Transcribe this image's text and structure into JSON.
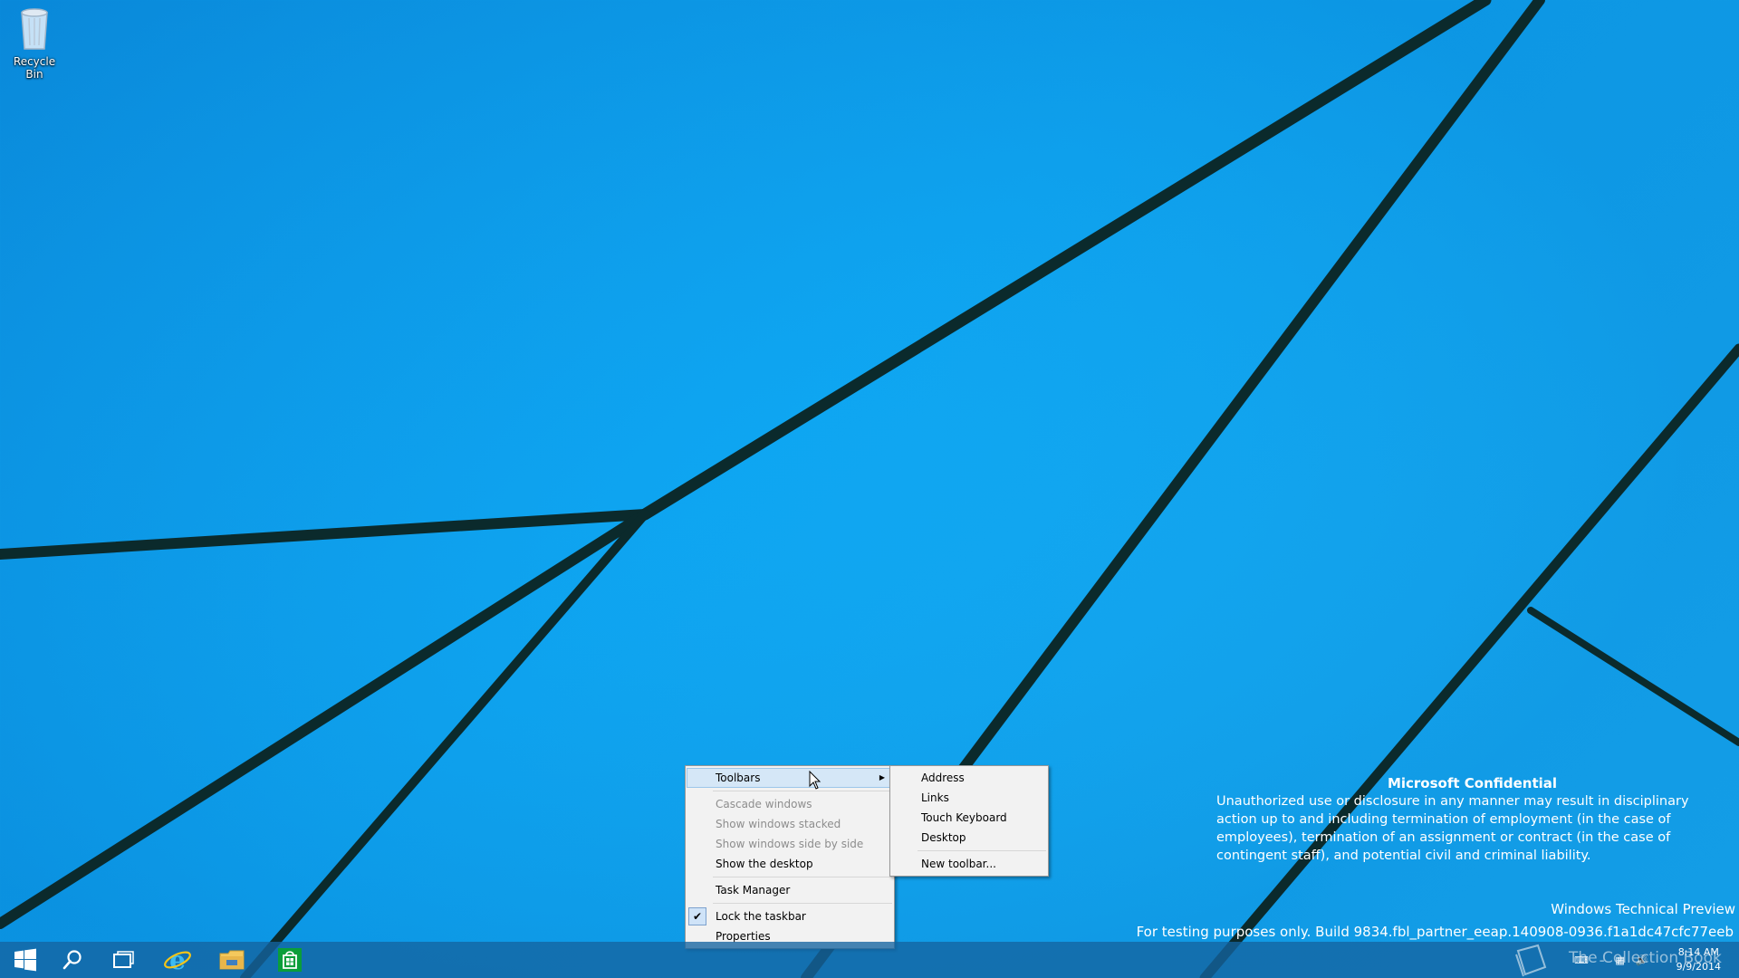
{
  "desktop": {
    "icons": [
      {
        "label": "Recycle Bin",
        "icon": "recycle-bin-icon"
      }
    ]
  },
  "context_menu": {
    "items": [
      {
        "label": "Toolbars",
        "state": "hover",
        "has_submenu": true
      },
      {
        "label": "Cascade windows",
        "state": "disabled"
      },
      {
        "label": "Show windows stacked",
        "state": "disabled"
      },
      {
        "label": "Show windows side by side",
        "state": "disabled"
      },
      {
        "label": "Show the desktop",
        "state": "enabled"
      },
      {
        "label": "Task Manager",
        "state": "enabled"
      },
      {
        "label": "Lock the taskbar",
        "state": "checked"
      },
      {
        "label": "Properties",
        "state": "enabled"
      }
    ]
  },
  "toolbars_submenu": {
    "items": [
      {
        "label": "Address"
      },
      {
        "label": "Links"
      },
      {
        "label": "Touch Keyboard"
      },
      {
        "label": "Desktop"
      },
      {
        "label": "New toolbar..."
      }
    ]
  },
  "notice": {
    "title": "Microsoft Confidential",
    "body": "Unauthorized use or disclosure in any manner may result in disciplinary action up to and including termination of employment (in the case of employees), termination of an assignment or contract (in the case of contingent staff), and potential civil and criminal liability."
  },
  "watermark": {
    "edition": "Windows Technical Preview",
    "build": "For testing purposes only. Build 9834.fbl_partner_eeap.140908-0936.f1a1dc47cfc77eeb"
  },
  "taskbar": {
    "pinned": [
      {
        "name": "start-button",
        "icon": "windows-logo-icon"
      },
      {
        "name": "search-button",
        "icon": "search-icon"
      },
      {
        "name": "task-view-button",
        "icon": "task-view-icon"
      },
      {
        "name": "internet-explorer",
        "icon": "ie-icon"
      },
      {
        "name": "file-explorer",
        "icon": "folder-icon"
      },
      {
        "name": "store",
        "icon": "store-icon"
      }
    ],
    "clock_time": "8:14 AM",
    "clock_date": "9/9/2014",
    "collection_watermark": "The Collection Book"
  },
  "colors": {
    "wallpaper": "#0ea6f2",
    "taskbar": "#1564a0",
    "menu_bg": "#f2f2f2",
    "menu_hover": "#d5e7f7"
  }
}
